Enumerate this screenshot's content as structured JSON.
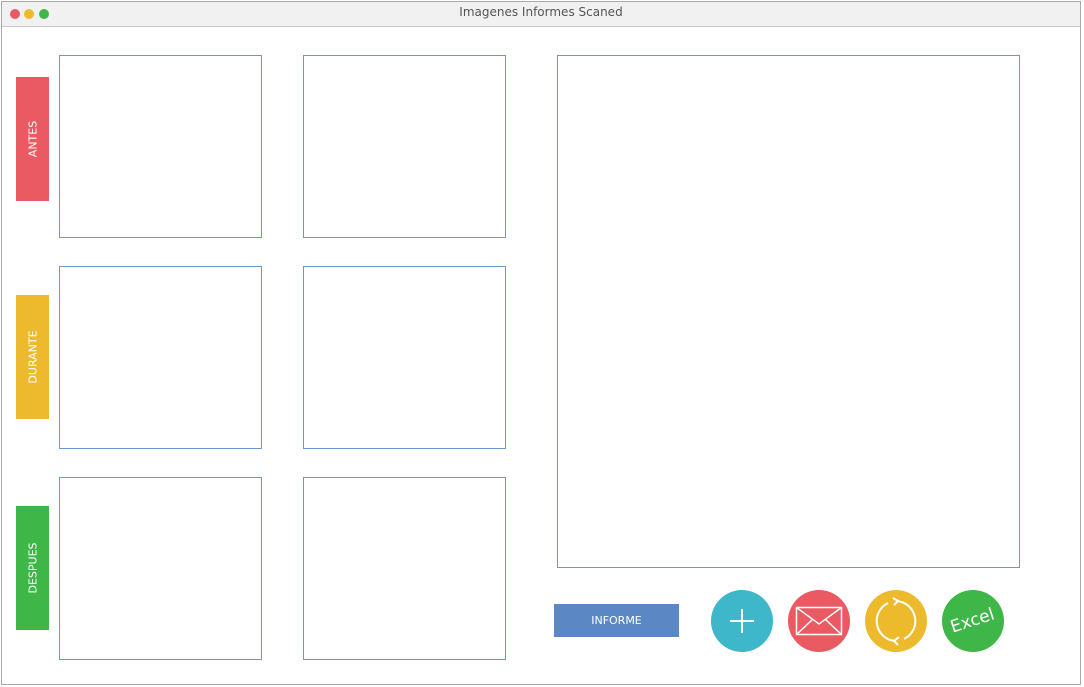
{
  "window": {
    "title": "Imagenes Informes Scaned"
  },
  "colors": {
    "red": "#e95a62",
    "yellow": "#edba2e",
    "green": "#3fb748",
    "teal": "#3db7c9",
    "blue": "#5b87c5"
  },
  "sections": {
    "antes": "ANTES",
    "durante": "DURANTE",
    "despues": "DESPUES"
  },
  "actions": {
    "informe_label": "INFORME",
    "excel_label": "Excel",
    "add_icon": "plus-icon",
    "mail_icon": "envelope-icon",
    "refresh_icon": "refresh-icon"
  }
}
